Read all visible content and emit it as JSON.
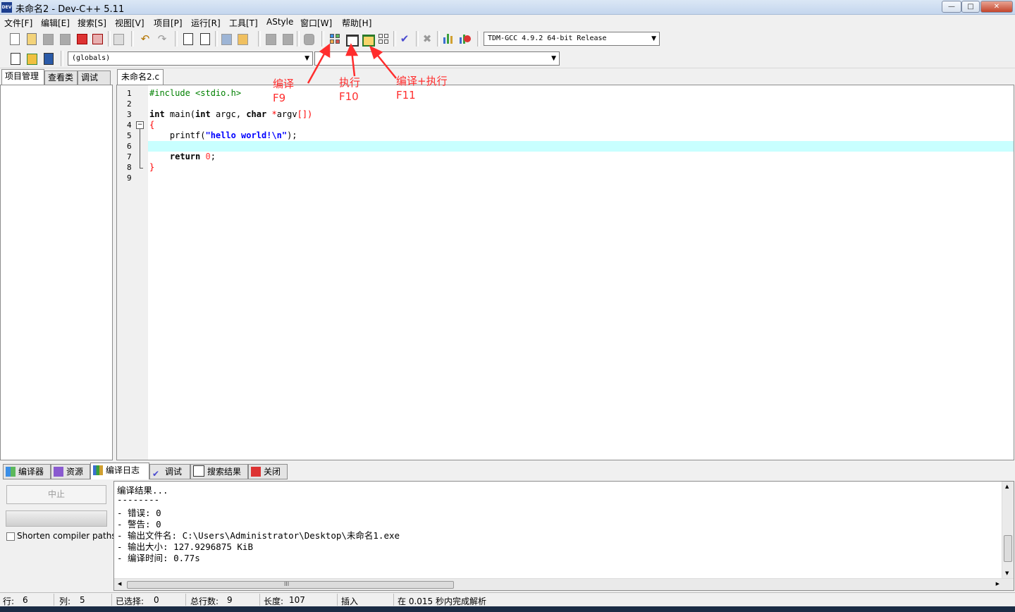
{
  "window": {
    "icon_text": "DEV",
    "title": "未命名2 - Dev-C++ 5.11",
    "min_glyph": "—",
    "max_glyph": "□",
    "close_glyph": "✕"
  },
  "menu": [
    "文件[F]",
    "编辑[E]",
    "搜索[S]",
    "视图[V]",
    "项目[P]",
    "运行[R]",
    "工具[T]",
    "AStyle",
    "窗口[W]",
    "帮助[H]"
  ],
  "toolbar": {
    "compiler_selected": "TDM-GCC 4.9.2 64-bit Release",
    "scope_selected": "(globals)",
    "function_selected": ""
  },
  "left_tabs": [
    "项目管理",
    "查看类",
    "调试"
  ],
  "editor": {
    "tab_label": "未命名2.c",
    "line_numbers": [
      "1",
      "2",
      "3",
      "4",
      "5",
      "6",
      "7",
      "8",
      "9"
    ],
    "code": {
      "l1": "#include <stdio.h>",
      "l3_kw1": "int",
      "l3_a": " main(",
      "l3_kw2": "int",
      "l3_b": " argc, ",
      "l3_kw3": "char",
      "l3_c": " ",
      "l3_star": "*",
      "l3_d": "argv",
      "l3_br": "[])",
      "l4": "{",
      "l5_a": "    printf(",
      "l5_str": "\"hello world!\\n\"",
      "l5_b": ");",
      "l7_kw": "    return",
      "l7_a": " ",
      "l7_num": "0",
      "l7_b": ";",
      "l8": "}"
    },
    "active_line": 6
  },
  "annotations": {
    "compile": {
      "label": "编译",
      "key": "F9"
    },
    "run": {
      "label": "执行",
      "key": "F10"
    },
    "compile_run": {
      "label": "编译+执行",
      "key": "F11"
    }
  },
  "bottom_tabs": [
    "编译器",
    "资源",
    "编译日志",
    "调试",
    "搜索结果",
    "关闭"
  ],
  "compile_log": {
    "abort_label": "中止",
    "shorten_label": "Shorten compiler paths",
    "lines": [
      "编译结果...",
      "--------",
      "- 错误: 0",
      "- 警告: 0",
      "- 输出文件名: C:\\Users\\Administrator\\Desktop\\未命名1.exe",
      "- 输出大小: 127.9296875 KiB",
      "- 编译时间: 0.77s"
    ],
    "hscroll_grip": "III"
  },
  "status": {
    "row_label": "行:",
    "row": "6",
    "col_label": "列:",
    "col": "5",
    "sel_label": "已选择:",
    "sel": "0",
    "lines_label": "总行数:",
    "lines": "9",
    "len_label": "长度:",
    "len": "107",
    "mode": "插入",
    "message": "在 0.015 秒内完成解析"
  },
  "colors": {
    "active_line_bg": "#c8ffff",
    "preprocessor": "#008000",
    "string": "#0000ff",
    "number": "#ff3333",
    "annotation": "#ff2d2d"
  }
}
